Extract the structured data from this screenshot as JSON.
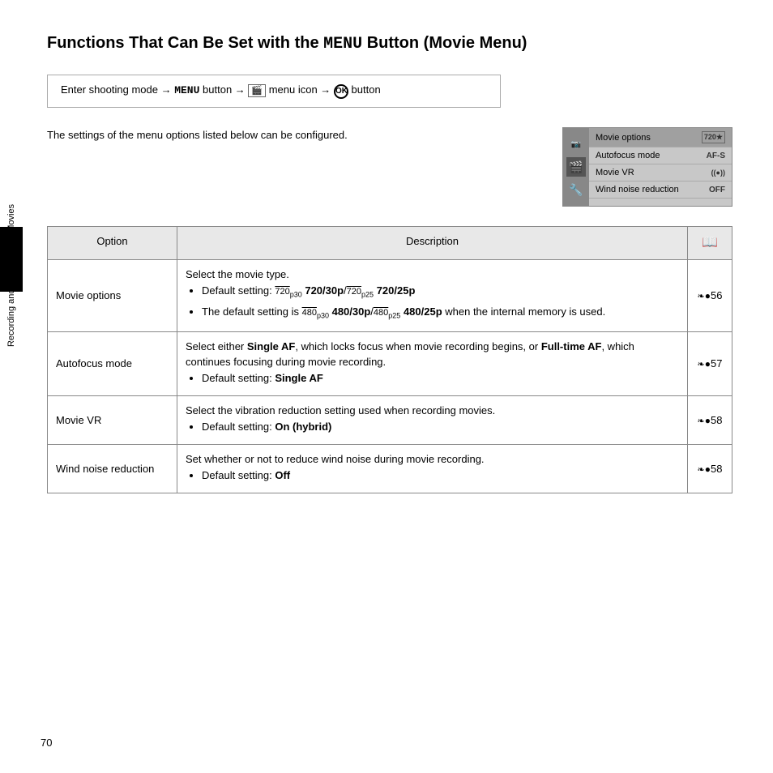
{
  "page": {
    "title_part1": "Functions That Can Be Set with the ",
    "title_menu_word": "MENU",
    "title_part2": " Button (Movie Menu)",
    "side_tab_text": "Recording and Playing Back Movies",
    "page_number": "70"
  },
  "nav_box": {
    "text": "Enter shooting mode → ",
    "menu": "MENU",
    "text2": " button → ",
    "icon_movie": "🎬",
    "text3": " menu icon → ",
    "ok": "OK",
    "text4": " button"
  },
  "intro": {
    "text": "The settings of the menu options listed below can be configured."
  },
  "camera_menu": {
    "rows": [
      {
        "label": "Movie options",
        "value": "720★"
      },
      {
        "label": "Autofocus mode",
        "value": "AF-S"
      },
      {
        "label": "Movie VR",
        "value": "((●))"
      },
      {
        "label": "Wind noise reduction",
        "value": "OFF"
      }
    ]
  },
  "table": {
    "headers": [
      "Option",
      "Description",
      "📖"
    ],
    "rows": [
      {
        "option": "Movie options",
        "description_html": "movie_options",
        "ref": "❧56"
      },
      {
        "option": "Autofocus mode",
        "description_html": "autofocus_mode",
        "ref": "❧57"
      },
      {
        "option": "Movie VR",
        "description_html": "movie_vr",
        "ref": "❧58"
      },
      {
        "option": "Wind noise reduction",
        "description_html": "wind_noise",
        "ref": "❧58"
      }
    ]
  }
}
